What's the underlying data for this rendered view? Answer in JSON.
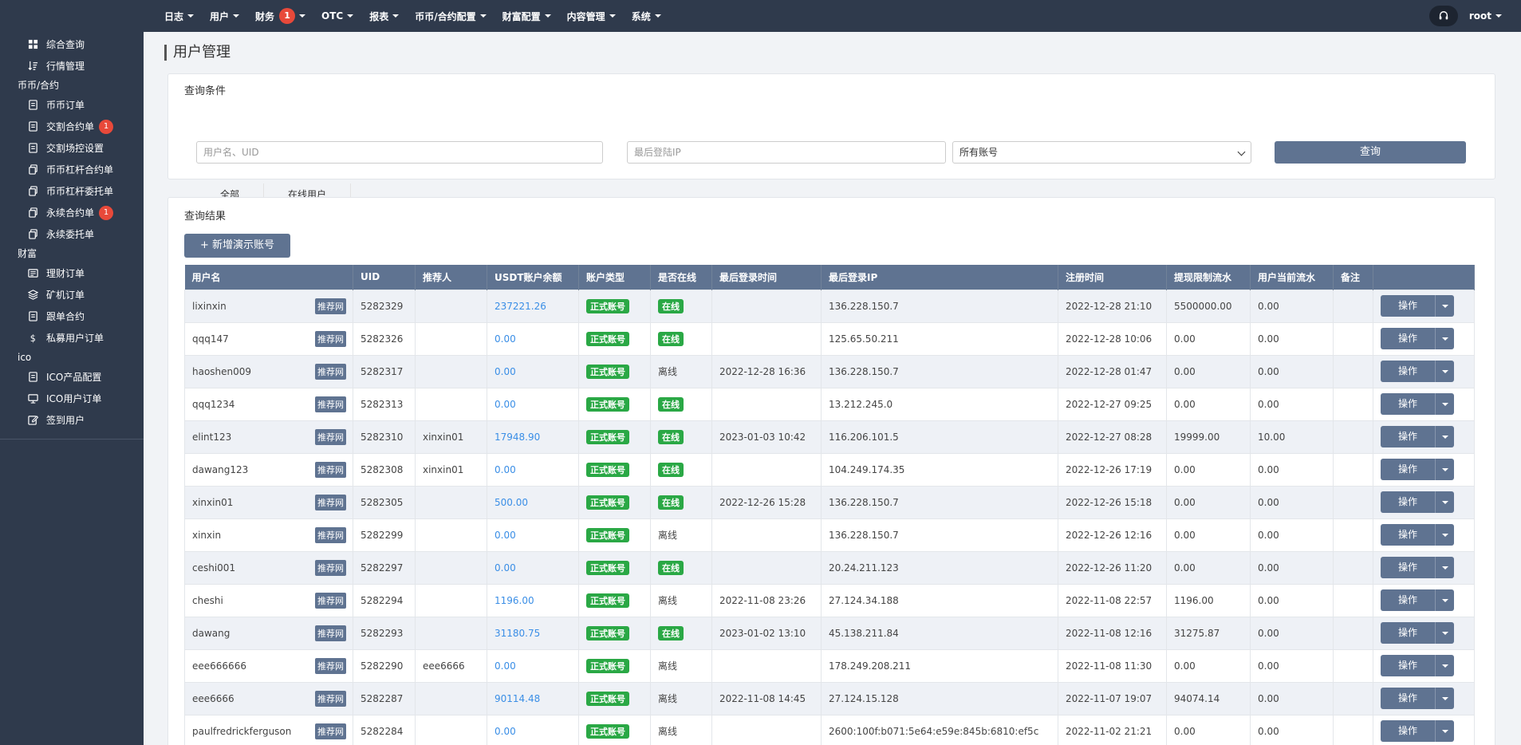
{
  "topnav": [
    {
      "label": "日志",
      "badge": ""
    },
    {
      "label": "用户",
      "badge": ""
    },
    {
      "label": "财务",
      "badge": "1"
    },
    {
      "label": "OTC",
      "badge": ""
    },
    {
      "label": "报表",
      "badge": ""
    },
    {
      "label": "币币/合约配置",
      "badge": ""
    },
    {
      "label": "财富配置",
      "badge": ""
    },
    {
      "label": "内容管理",
      "badge": ""
    },
    {
      "label": "系统",
      "badge": ""
    }
  ],
  "user": {
    "name": "root",
    "help_icon": "headset-icon"
  },
  "sidebar": {
    "top_items": [
      {
        "label": "综合查询",
        "icon": "grid-icon"
      },
      {
        "label": "行情管理",
        "icon": "sort-icon"
      }
    ],
    "group1": "币币/合约",
    "group1_items": [
      {
        "label": "币币订单",
        "icon": "doc-icon",
        "badge": ""
      },
      {
        "label": "交割合约单",
        "icon": "doc-icon",
        "badge": "1"
      },
      {
        "label": "交割场控设置",
        "icon": "doc-icon",
        "badge": ""
      },
      {
        "label": "币币杠杆合约单",
        "icon": "copy-icon",
        "badge": ""
      },
      {
        "label": "币币杠杆委托单",
        "icon": "copy-icon",
        "badge": ""
      },
      {
        "label": "永续合约单",
        "icon": "copy-icon",
        "badge": "1"
      },
      {
        "label": "永续委托单",
        "icon": "copy-icon",
        "badge": ""
      }
    ],
    "group2": "财富",
    "group2_items": [
      {
        "label": "理财订单",
        "icon": "list-icon"
      },
      {
        "label": "矿机订单",
        "icon": "layers-icon"
      },
      {
        "label": "跟单合约",
        "icon": "doc-icon"
      },
      {
        "label": "私募用户订单",
        "icon": "dollar-icon"
      }
    ],
    "group3": "ico",
    "group3_items": [
      {
        "label": "ICO产品配置",
        "icon": "doc-icon"
      },
      {
        "label": "ICO用户订单",
        "icon": "monitor-icon"
      },
      {
        "label": "签到用户",
        "icon": "edit-icon"
      }
    ]
  },
  "page": {
    "title": "用户管理",
    "query_title": "查询条件",
    "username_placeholder": "用户名、UID",
    "ip_placeholder": "最后登陆IP",
    "account_select": "所有账号",
    "query_button": "查询",
    "tabs": [
      "全部",
      "在线用户"
    ],
    "result_title": "查询结果",
    "add_button": "+ 新增演示账号"
  },
  "table": {
    "headers": [
      "用户名",
      "UID",
      "推荐人",
      "USDT账户余额",
      "账户类型",
      "是否在线",
      "最后登录时间",
      "最后登录IP",
      "注册时间",
      "提现限制流水",
      "用户当前流水",
      "备注",
      ""
    ],
    "tjw_label": "推荐网",
    "op_label": "操作",
    "rows": [
      {
        "username": "lixinxin",
        "uid": "5282329",
        "referrer": "",
        "usdt": "237221.26",
        "type": "正式账号",
        "online": "在线",
        "online_tag": true,
        "last_login": "",
        "ip": "136.228.150.7",
        "reg": "2022-12-28 21:10",
        "limit": "5500000.00",
        "current": "0.00",
        "note": ""
      },
      {
        "username": "qqq147",
        "uid": "5282326",
        "referrer": "",
        "usdt": "0.00",
        "type": "正式账号",
        "online": "在线",
        "online_tag": true,
        "last_login": "",
        "ip": "125.65.50.211",
        "reg": "2022-12-28 10:06",
        "limit": "0.00",
        "current": "0.00",
        "note": ""
      },
      {
        "username": "haoshen009",
        "uid": "5282317",
        "referrer": "",
        "usdt": "0.00",
        "type": "正式账号",
        "online": "离线",
        "online_tag": false,
        "last_login": "2022-12-28 16:36",
        "ip": "136.228.150.7",
        "reg": "2022-12-28 01:47",
        "limit": "0.00",
        "current": "0.00",
        "note": ""
      },
      {
        "username": "qqq1234",
        "uid": "5282313",
        "referrer": "",
        "usdt": "0.00",
        "type": "正式账号",
        "online": "在线",
        "online_tag": true,
        "last_login": "",
        "ip": "13.212.245.0",
        "reg": "2022-12-27 09:25",
        "limit": "0.00",
        "current": "0.00",
        "note": ""
      },
      {
        "username": "elint123",
        "uid": "5282310",
        "referrer": "xinxin01",
        "usdt": "17948.90",
        "type": "正式账号",
        "online": "在线",
        "online_tag": true,
        "last_login": "2023-01-03 10:42",
        "ip": "116.206.101.5",
        "reg": "2022-12-27 08:28",
        "limit": "19999.00",
        "current": "10.00",
        "note": ""
      },
      {
        "username": "dawang123",
        "uid": "5282308",
        "referrer": "xinxin01",
        "usdt": "0.00",
        "type": "正式账号",
        "online": "在线",
        "online_tag": true,
        "last_login": "",
        "ip": "104.249.174.35",
        "reg": "2022-12-26 17:19",
        "limit": "0.00",
        "current": "0.00",
        "note": ""
      },
      {
        "username": "xinxin01",
        "uid": "5282305",
        "referrer": "",
        "usdt": "500.00",
        "type": "正式账号",
        "online": "在线",
        "online_tag": true,
        "last_login": "2022-12-26 15:28",
        "ip": "136.228.150.7",
        "reg": "2022-12-26 15:18",
        "limit": "0.00",
        "current": "0.00",
        "note": ""
      },
      {
        "username": "xinxin",
        "uid": "5282299",
        "referrer": "",
        "usdt": "0.00",
        "type": "正式账号",
        "online": "离线",
        "online_tag": false,
        "last_login": "",
        "ip": "136.228.150.7",
        "reg": "2022-12-26 12:16",
        "limit": "0.00",
        "current": "0.00",
        "note": ""
      },
      {
        "username": "ceshi001",
        "uid": "5282297",
        "referrer": "",
        "usdt": "0.00",
        "type": "正式账号",
        "online": "在线",
        "online_tag": true,
        "last_login": "",
        "ip": "20.24.211.123",
        "reg": "2022-12-26 11:20",
        "limit": "0.00",
        "current": "0.00",
        "note": ""
      },
      {
        "username": "cheshi",
        "uid": "5282294",
        "referrer": "",
        "usdt": "1196.00",
        "type": "正式账号",
        "online": "离线",
        "online_tag": false,
        "last_login": "2022-11-08 23:26",
        "ip": "27.124.34.188",
        "reg": "2022-11-08 22:57",
        "limit": "1196.00",
        "current": "0.00",
        "note": ""
      },
      {
        "username": "dawang",
        "uid": "5282293",
        "referrer": "",
        "usdt": "31180.75",
        "type": "正式账号",
        "online": "在线",
        "online_tag": true,
        "last_login": "2023-01-02 13:10",
        "ip": "45.138.211.84",
        "reg": "2022-11-08 12:16",
        "limit": "31275.87",
        "current": "0.00",
        "note": ""
      },
      {
        "username": "eee666666",
        "uid": "5282290",
        "referrer": "eee6666",
        "usdt": "0.00",
        "type": "正式账号",
        "online": "离线",
        "online_tag": false,
        "last_login": "",
        "ip": "178.249.208.211",
        "reg": "2022-11-08 11:30",
        "limit": "0.00",
        "current": "0.00",
        "note": ""
      },
      {
        "username": "eee6666",
        "uid": "5282287",
        "referrer": "",
        "usdt": "90114.48",
        "type": "正式账号",
        "online": "离线",
        "online_tag": false,
        "last_login": "2022-11-08 14:45",
        "ip": "27.124.15.128",
        "reg": "2022-11-07 19:07",
        "limit": "94074.14",
        "current": "0.00",
        "note": ""
      },
      {
        "username": "paulfredrickferguson",
        "uid": "5282284",
        "referrer": "",
        "usdt": "0.00",
        "type": "正式账号",
        "online": "离线",
        "online_tag": false,
        "last_login": "",
        "ip": "2600:100f:b071:5e64:e59e:845b:6810:ef5c",
        "reg": "2022-11-02 21:21",
        "limit": "0.00",
        "current": "0.00",
        "note": ""
      }
    ]
  }
}
